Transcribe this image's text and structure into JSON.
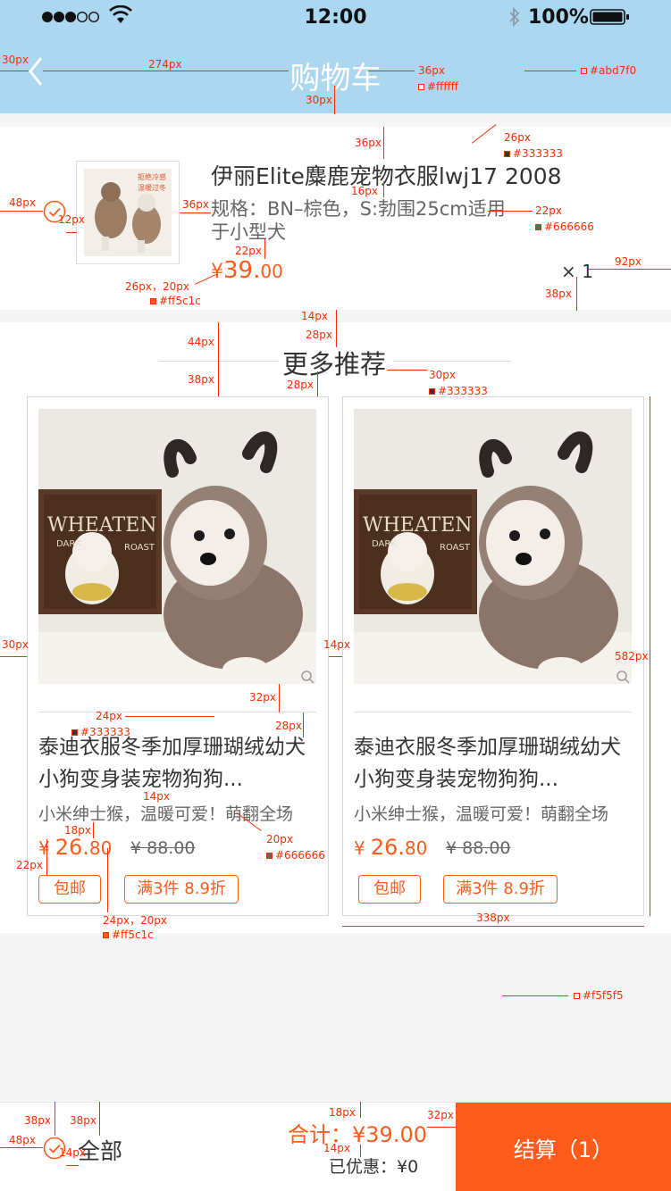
{
  "status_bar": {
    "time": "12:00",
    "battery": "100%"
  },
  "nav": {
    "title": "购物车"
  },
  "cart_item": {
    "name": "伊丽Elite麋鹿宠物衣服lwj17 2008",
    "spec": "规格：BN–棕色，S:勃围25cm适用于小型犬",
    "price_symbol": "¥",
    "price_int": "39.",
    "price_dec": "00",
    "qty": "× 1",
    "product_tag_line1": "拒绝冷感",
    "product_tag_line2": "温暖过冬"
  },
  "recommend": {
    "title": "更多推荐",
    "products": [
      {
        "title": "泰迪衣服冬季加厚珊瑚绒幼犬小狗变身装宠物狗狗...",
        "subtitle": "小米绅士猴，温暖可爱！萌翻全场",
        "price_symbol": "¥",
        "price_int": "26.",
        "price_dec": "80",
        "orig_price": "¥ 88.00",
        "tag1": "包邮",
        "tag2": "满3件 8.9折"
      },
      {
        "title": "泰迪衣服冬季加厚珊瑚绒幼犬小狗变身装宠物狗狗...",
        "subtitle": "小米绅士猴，温暖可爱！萌翻全场",
        "price_symbol": "¥",
        "price_int": "26.",
        "price_dec": "80",
        "orig_price": "¥ 88.00",
        "tag1": "包邮",
        "tag2": "满3件 8.9折"
      }
    ],
    "image_text": {
      "brand": "WHEATEN",
      "sub1": "DARK",
      "sub2": "ROAST"
    }
  },
  "bottom_bar": {
    "select_all": "全部",
    "total_label": "合计：",
    "total_value": "¥39.00",
    "discount": "已优惠：¥0",
    "checkout": "结算（1）"
  },
  "annotations": {
    "px30_a": "30px",
    "px274": "274px",
    "px36_a": "36px",
    "px30_b": "30px",
    "c_ffffff": "#ffffff",
    "c_abd7f0": "#abd7f0",
    "px36_b": "36px",
    "px26_a": "26px",
    "c_333333_a": "#333333",
    "px16": "16px",
    "px48_a": "48px",
    "px12": "12px",
    "px36_c": "36px",
    "px22_a": "22px",
    "c_666666_a": "#666666",
    "px22_b": "22px",
    "px26_20": "26px，20px",
    "c_ff5c1c_a": "#ff5c1c",
    "px92": "92px",
    "px38_a": "38px",
    "px14_a": "14px",
    "px28_a": "28px",
    "px44": "44px",
    "px38_b": "38px",
    "px28_b": "28px",
    "px30_c": "30px",
    "c_333333_b": "#333333",
    "px30_d": "30px",
    "px14_b": "14px",
    "px582": "582px",
    "px32_a": "32px",
    "px28_c": "28px",
    "px24_a": "24px",
    "c_333333_c": "#333333",
    "px14_c": "14px",
    "px18_a": "18px",
    "px20": "20px",
    "c_666666_b": "#666666",
    "px22_c": "22px",
    "px24_20": "24px，20px",
    "c_ff5c1c_b": "#ff5c1c",
    "px338": "338px",
    "c_f5f5f5": "#f5f5f5",
    "px38_c": "38px",
    "px38_d": "38px",
    "px48_b": "48px",
    "px14_d": "14px",
    "px18_b": "18px",
    "px14_e": "14px",
    "px32_b": "32px"
  }
}
